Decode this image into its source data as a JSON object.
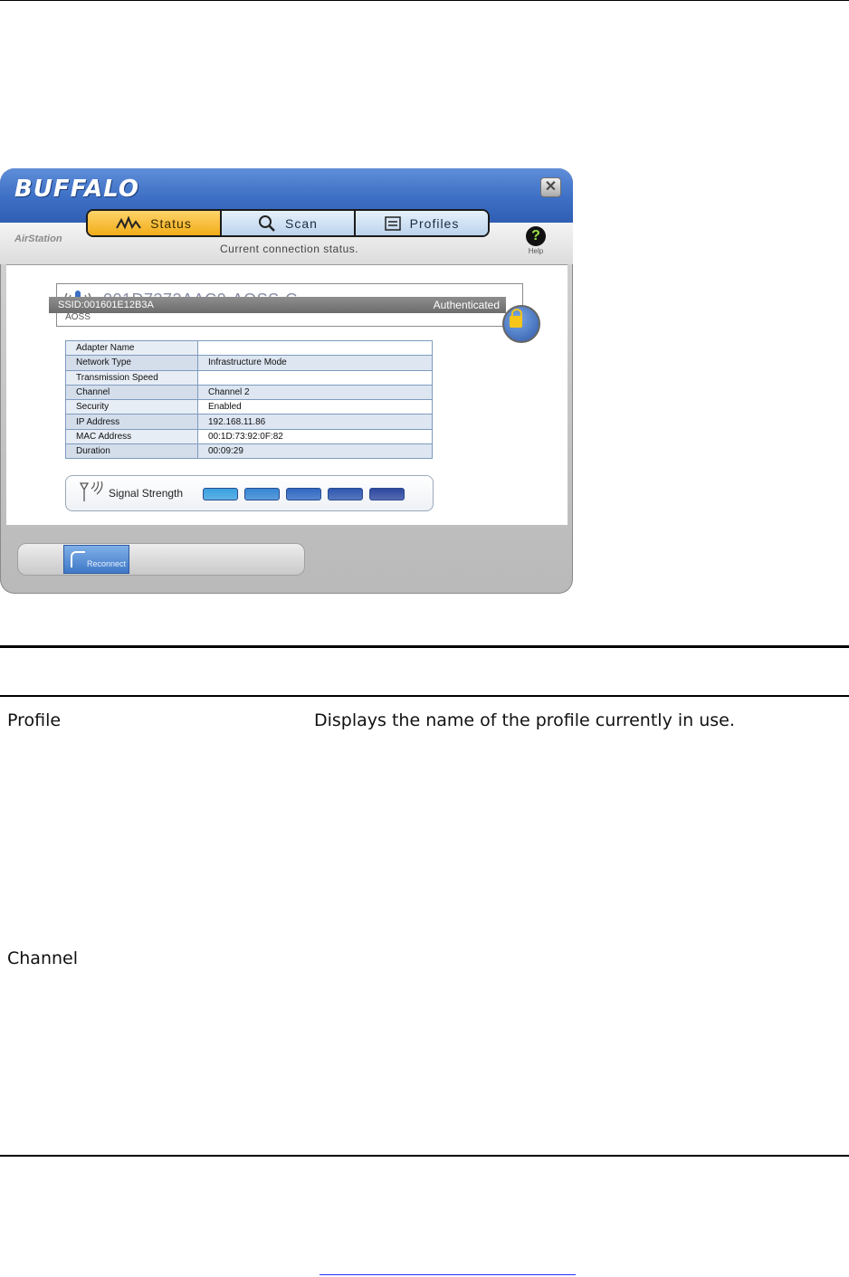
{
  "window": {
    "brand": "BUFFALO",
    "product": "AirStation",
    "close_glyph": "✕",
    "subtitle": "Current connection status.",
    "help_label": "Help",
    "tabs": [
      {
        "label": "Status",
        "icon": "status-wave-icon",
        "active": true
      },
      {
        "label": "Scan",
        "icon": "magnifier-icon",
        "active": false
      },
      {
        "label": "Profiles",
        "icon": "profiles-list-icon",
        "active": false
      }
    ]
  },
  "connection": {
    "aoss_label": "AOSS",
    "profile_name": "001D7373AAC0-AOSS-G",
    "ssid": "SSID:001601E12B3A",
    "auth_status": "Authenticated"
  },
  "info_table": [
    {
      "key": "Adapter Name",
      "value": ""
    },
    {
      "key": "Network Type",
      "value": "Infrastructure Mode"
    },
    {
      "key": "Transmission Speed",
      "value": ""
    },
    {
      "key": "Channel",
      "value": "Channel 2"
    },
    {
      "key": "Security",
      "value": "Enabled"
    },
    {
      "key": "IP Address",
      "value": "192.168.11.86"
    },
    {
      "key": "MAC Address",
      "value": "00:1D:73:92:0F:82"
    },
    {
      "key": "Duration",
      "value": "00:09:29"
    }
  ],
  "signal": {
    "label": "Signal Strength",
    "level": 5,
    "max": 5,
    "bar_colors": [
      "#3aa0e0",
      "#3586d4",
      "#3068c2",
      "#2f57b0",
      "#2e48a0"
    ]
  },
  "bottom": {
    "reconnect_label": "Reconnect"
  },
  "doc": {
    "rows": [
      {
        "term": "Profile",
        "description": "Displays the name of the profile currently in use."
      },
      {
        "term": "Channel",
        "description": ""
      }
    ]
  }
}
